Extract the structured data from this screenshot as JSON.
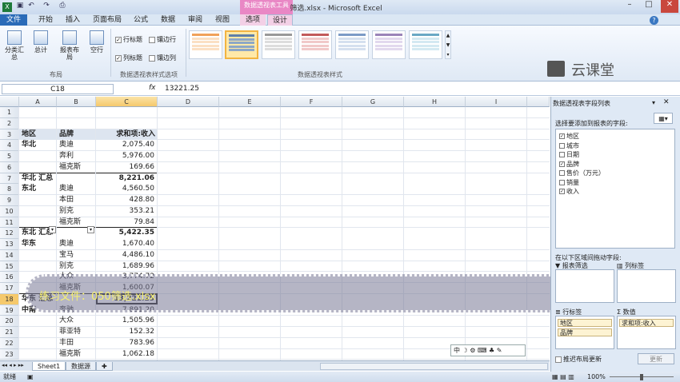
{
  "window": {
    "title": "筛选.xlsx - Microsoft Excel",
    "context_group": "数据透视表工具"
  },
  "tabs": [
    "文件",
    "开始",
    "插入",
    "页面布局",
    "公式",
    "数据",
    "审阅",
    "视图",
    "选项",
    "设计"
  ],
  "ribbon": {
    "layout_buttons": [
      "分类汇总",
      "总计",
      "报表布局",
      "空行"
    ],
    "layout_group": "布局",
    "options": [
      {
        "label": "行标题",
        "checked": true
      },
      {
        "label": "镶边行",
        "checked": false
      },
      {
        "label": "列标题",
        "checked": true
      },
      {
        "label": "镶边列",
        "checked": false
      }
    ],
    "options_group": "数据透视表样式选项",
    "styles_group": "数据透视表样式"
  },
  "logo": {
    "text": "云课堂"
  },
  "formula_bar": {
    "name_box": "C18",
    "fx": "fx",
    "value": "13221.25"
  },
  "columns": [
    "A",
    "B",
    "C",
    "D",
    "E",
    "F",
    "G",
    "H",
    "I"
  ],
  "rows": [
    {
      "n": "1",
      "a": "",
      "b": "",
      "c": ""
    },
    {
      "n": "2",
      "a": "",
      "b": "",
      "c": ""
    },
    {
      "n": "3",
      "a": "地区",
      "b": "品牌",
      "c": "求和项:收入",
      "header": true
    },
    {
      "n": "4",
      "a": "华北",
      "b": "奥迪",
      "c": "2,075.40"
    },
    {
      "n": "5",
      "a": "",
      "b": "奔利",
      "c": "5,976.00"
    },
    {
      "n": "6",
      "a": "",
      "b": "福克斯",
      "c": "169.66"
    },
    {
      "n": "7",
      "a": "华北 汇总",
      "b": "",
      "c": "8,221.06",
      "total": true
    },
    {
      "n": "8",
      "a": "东北",
      "b": "奥迪",
      "c": "4,560.50"
    },
    {
      "n": "9",
      "a": "",
      "b": "本田",
      "c": "428.80"
    },
    {
      "n": "10",
      "a": "",
      "b": "别克",
      "c": "353.21"
    },
    {
      "n": "11",
      "a": "",
      "b": "福克斯",
      "c": "79.84"
    },
    {
      "n": "12",
      "a": "东北 汇总",
      "b": "",
      "c": "5,422.35",
      "total": true
    },
    {
      "n": "13",
      "a": "华东",
      "b": "奥迪",
      "c": "1,670.40"
    },
    {
      "n": "14",
      "a": "",
      "b": "宝马",
      "c": "4,486.10"
    },
    {
      "n": "15",
      "a": "",
      "b": "别克",
      "c": "1,689.96"
    },
    {
      "n": "16",
      "a": "",
      "b": "大众",
      "c": "3,774.72"
    },
    {
      "n": "17",
      "a": "",
      "b": "福克斯",
      "c": "1,600.07"
    },
    {
      "n": "18",
      "a": "华东 汇总",
      "b": "",
      "c": "13,221.25",
      "total": true
    },
    {
      "n": "19",
      "a": "中南",
      "b": "奔驰",
      "c": "7,891.20"
    },
    {
      "n": "20",
      "a": "",
      "b": "大众",
      "c": "1,505.96"
    },
    {
      "n": "21",
      "a": "",
      "b": "菲亚特",
      "c": "152.32"
    },
    {
      "n": "22",
      "a": "",
      "b": "丰田",
      "c": "783.96"
    },
    {
      "n": "23",
      "a": "",
      "b": "福克斯",
      "c": "1,062.18"
    }
  ],
  "watermark": {
    "text": "练习文件：050筛选.xlsx"
  },
  "sheets": [
    "Sheet1",
    "数据源"
  ],
  "status": {
    "ready": "就绪",
    "zoom": "100%"
  },
  "field_pane": {
    "title": "数据透视表字段列表",
    "choose_label": "选择要添加到报表的字段:",
    "fields": [
      {
        "label": "地区",
        "checked": true
      },
      {
        "label": "城市",
        "checked": false
      },
      {
        "label": "日期",
        "checked": false
      },
      {
        "label": "品牌",
        "checked": true
      },
      {
        "label": "售价（万元）",
        "checked": false
      },
      {
        "label": "销量",
        "checked": false
      },
      {
        "label": "收入",
        "checked": true
      }
    ],
    "drag_label": "在以下区域间拖动字段:",
    "report_filter": "报表筛选",
    "column_labels": "列标签",
    "row_labels": "行标签",
    "values": "数值",
    "row_items": [
      "地区",
      "品牌"
    ],
    "value_items": [
      "求和项:收入"
    ],
    "defer_label": "推迟布局更新",
    "update_button": "更新"
  }
}
